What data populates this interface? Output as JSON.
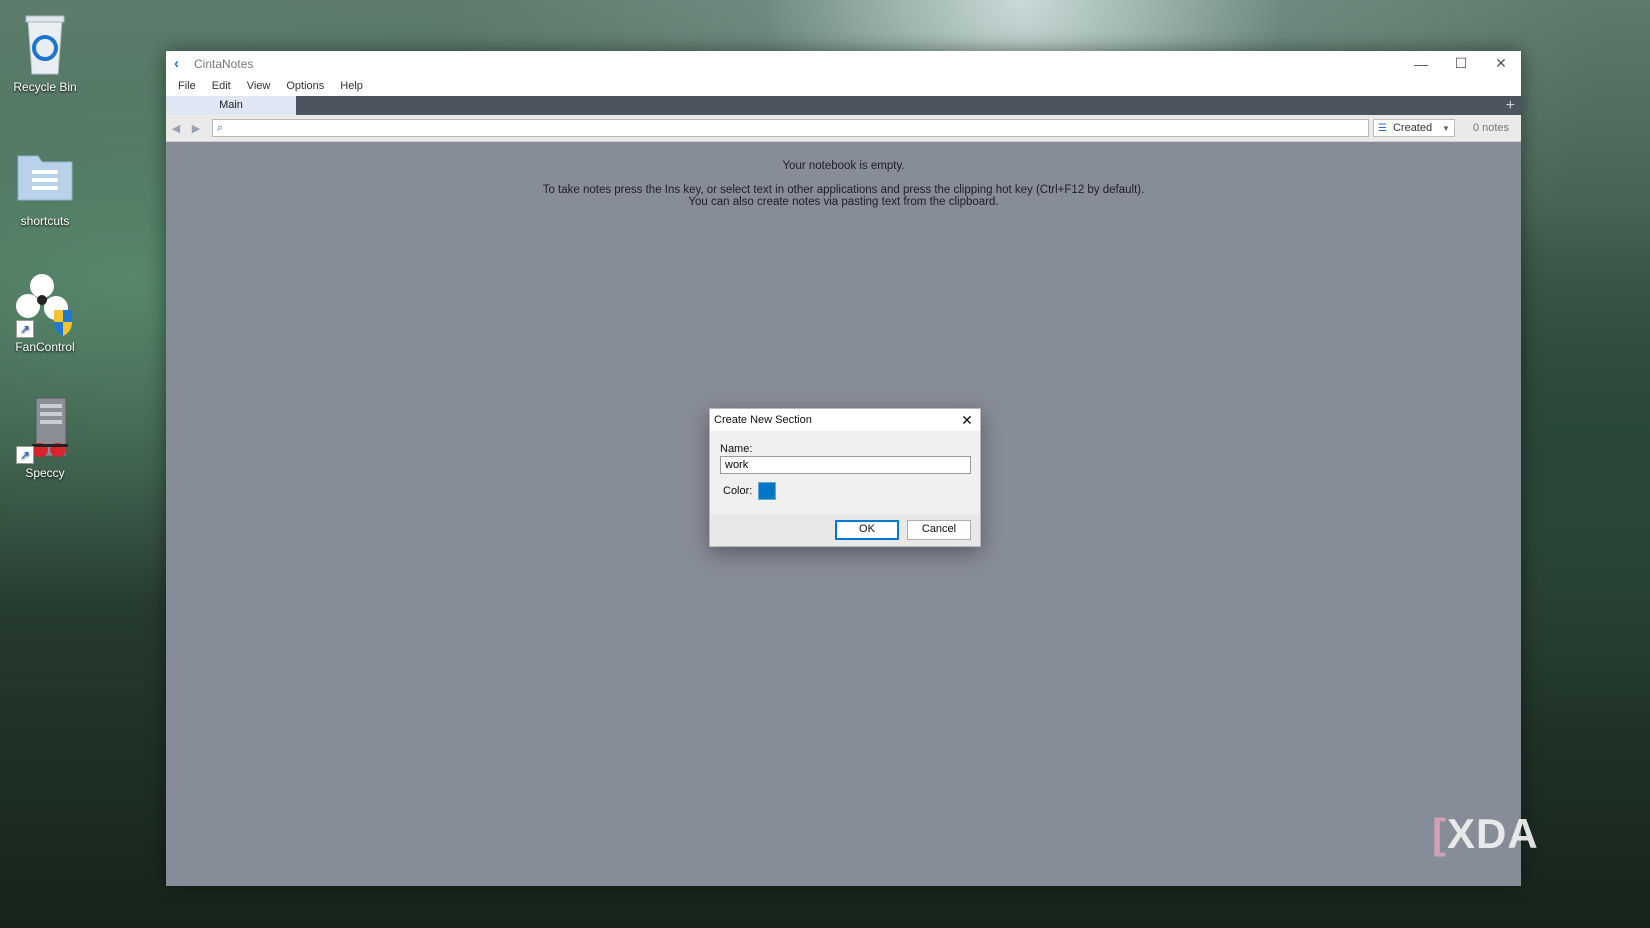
{
  "desktop": {
    "icons": [
      {
        "label": "Recycle Bin",
        "icon": "recycle-bin-icon"
      },
      {
        "label": "shortcuts",
        "icon": "folder-icon"
      },
      {
        "label": "FanControl",
        "icon": "fan-icon"
      },
      {
        "label": "Speccy",
        "icon": "speccy-icon"
      }
    ]
  },
  "window": {
    "title": "CintaNotes",
    "controls": {
      "minimize": "—",
      "maximize": "☐",
      "close": "✕"
    },
    "menu": [
      "File",
      "Edit",
      "View",
      "Options",
      "Help"
    ],
    "tabs": [
      {
        "label": "Main"
      }
    ],
    "tab_add": "+",
    "toolbar": {
      "back": "◀",
      "forward": "▶",
      "search_value": "",
      "sort_label": "Created",
      "note_count": "0 notes"
    },
    "content": {
      "empty_message": "Your notebook is empty.",
      "hint_line1": "To take notes press the Ins key, or select text in other applications and press the clipping hot key (Ctrl+F12 by default).",
      "hint_line2": "You can also create notes via pasting text from the clipboard."
    }
  },
  "dialog": {
    "title": "Create New Section",
    "close": "✕",
    "name_label": "Name:",
    "name_value": "work",
    "color_label": "Color:",
    "color_value": "#0078c8",
    "ok_label": "OK",
    "cancel_label": "Cancel"
  },
  "watermark": {
    "text": "XDA"
  }
}
